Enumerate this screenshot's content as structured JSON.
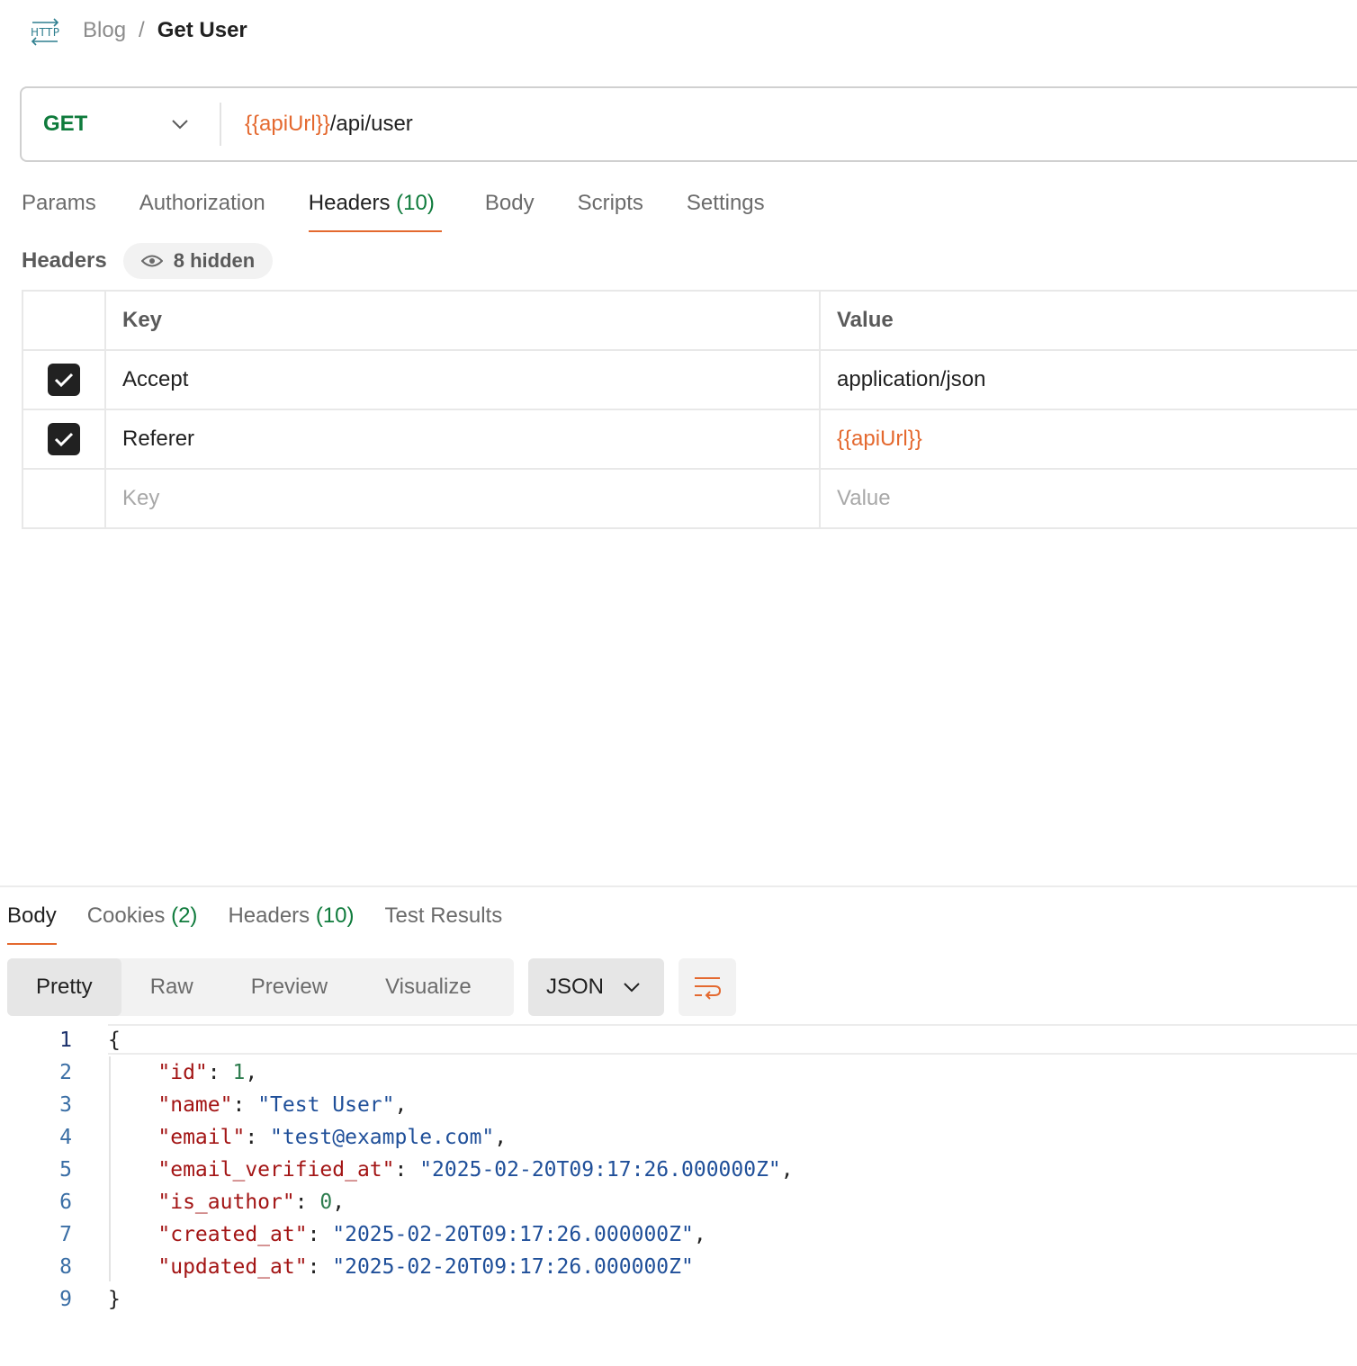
{
  "breadcrumb": {
    "icon": "http-icon",
    "parent": "Blog",
    "separator": "/",
    "title": "Get User"
  },
  "request": {
    "method": "GET",
    "url_variable": "{{apiUrl}}",
    "url_path": "/api/user"
  },
  "request_tabs": [
    {
      "label": "Params"
    },
    {
      "label": "Authorization"
    },
    {
      "label": "Headers",
      "count": "(10)",
      "active": true
    },
    {
      "label": "Body"
    },
    {
      "label": "Scripts"
    },
    {
      "label": "Settings"
    }
  ],
  "headers_section": {
    "label": "Headers",
    "hidden_label": "8 hidden"
  },
  "headers_table": {
    "col_key": "Key",
    "col_value": "Value",
    "rows": [
      {
        "checked": true,
        "key": "Accept",
        "value": "application/json"
      },
      {
        "checked": true,
        "key": "Referer",
        "value": "{{apiUrl}}"
      }
    ],
    "placeholder_key": "Key",
    "placeholder_value": "Value"
  },
  "response_tabs": [
    {
      "label": "Body",
      "active": true
    },
    {
      "label": "Cookies",
      "count": "(2)"
    },
    {
      "label": "Headers",
      "count": "(10)"
    },
    {
      "label": "Test Results"
    }
  ],
  "view_modes": [
    "Pretty",
    "Raw",
    "Preview",
    "Visualize"
  ],
  "active_view": "Pretty",
  "format": "JSON",
  "code_lines": [
    {
      "n": "1",
      "parts": [
        [
          "p",
          "{"
        ]
      ]
    },
    {
      "n": "2",
      "parts": [
        [
          "p",
          "    "
        ],
        [
          "k",
          "\"id\""
        ],
        [
          "p",
          ": "
        ],
        [
          "n",
          "1"
        ],
        [
          "p",
          ","
        ]
      ]
    },
    {
      "n": "3",
      "parts": [
        [
          "p",
          "    "
        ],
        [
          "k",
          "\"name\""
        ],
        [
          "p",
          ": "
        ],
        [
          "s",
          "\"Test User\""
        ],
        [
          "p",
          ","
        ]
      ]
    },
    {
      "n": "4",
      "parts": [
        [
          "p",
          "    "
        ],
        [
          "k",
          "\"email\""
        ],
        [
          "p",
          ": "
        ],
        [
          "s",
          "\"test@example.com\""
        ],
        [
          "p",
          ","
        ]
      ]
    },
    {
      "n": "5",
      "parts": [
        [
          "p",
          "    "
        ],
        [
          "k",
          "\"email_verified_at\""
        ],
        [
          "p",
          ": "
        ],
        [
          "s",
          "\"2025-02-20T09:17:26.000000Z\""
        ],
        [
          "p",
          ","
        ]
      ]
    },
    {
      "n": "6",
      "parts": [
        [
          "p",
          "    "
        ],
        [
          "k",
          "\"is_author\""
        ],
        [
          "p",
          ": "
        ],
        [
          "n",
          "0"
        ],
        [
          "p",
          ","
        ]
      ]
    },
    {
      "n": "7",
      "parts": [
        [
          "p",
          "    "
        ],
        [
          "k",
          "\"created_at\""
        ],
        [
          "p",
          ": "
        ],
        [
          "s",
          "\"2025-02-20T09:17:26.000000Z\""
        ],
        [
          "p",
          ","
        ]
      ]
    },
    {
      "n": "8",
      "parts": [
        [
          "p",
          "    "
        ],
        [
          "k",
          "\"updated_at\""
        ],
        [
          "p",
          ": "
        ],
        [
          "s",
          "\"2025-02-20T09:17:26.000000Z\""
        ]
      ]
    },
    {
      "n": "9",
      "parts": [
        [
          "p",
          "}"
        ]
      ]
    }
  ],
  "colors": {
    "accent": "#e4692f",
    "method_green": "#0f7b3c",
    "json_key": "#a31515",
    "json_string": "#1f4f99",
    "json_number": "#2e7d4f"
  }
}
